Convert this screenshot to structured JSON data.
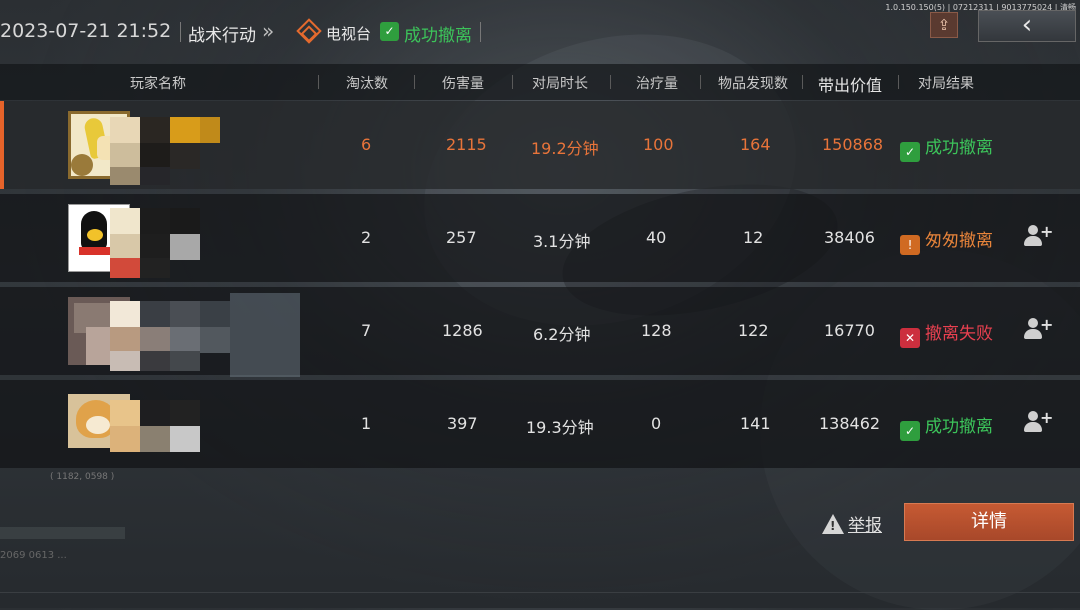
{
  "topbar": {
    "timestamp": "2023-07-21 21:52",
    "mode": "战术行动",
    "chevron": "»",
    "tv_label": "电视台",
    "status_icon": "✓",
    "status_label": "成功撤离",
    "build_info": "1.0.150.150(5) | 07212311 | 9013775024 | 清畅",
    "share_icon": "share-icon",
    "back_icon": "back-arrow-icon",
    "share_glyph": "⇪",
    "back_glyph": "‹"
  },
  "table": {
    "columns": [
      "玩家名称",
      "淘汰数",
      "伤害量",
      "对局时长",
      "治疗量",
      "物品发现数",
      "带出价值",
      "对局结果"
    ],
    "rows": [
      {
        "eliminations": "6",
        "damage": "2115",
        "duration": "19.2分钟",
        "healing": "100",
        "items": "164",
        "value": "150868",
        "result": "成功撤离",
        "result_type": "ok",
        "result_icon": "✓",
        "highlight": true
      },
      {
        "eliminations": "2",
        "damage": "257",
        "duration": "3.1分钟",
        "healing": "40",
        "items": "12",
        "value": "38406",
        "result": "匆匆撤离",
        "result_type": "hurry",
        "result_icon": "!",
        "highlight": false
      },
      {
        "eliminations": "7",
        "damage": "1286",
        "duration": "6.2分钟",
        "healing": "128",
        "items": "122",
        "value": "16770",
        "result": "撤离失败",
        "result_type": "fail",
        "result_icon": "✕",
        "highlight": false
      },
      {
        "eliminations": "1",
        "damage": "397",
        "duration": "19.3分钟",
        "healing": "0",
        "items": "141",
        "value": "138462",
        "result": "成功撤离",
        "result_type": "ok",
        "result_icon": "✓",
        "highlight": false
      }
    ]
  },
  "footer": {
    "coords": "( 1182, 0598 )",
    "report_label": "举报",
    "detail_label": "详情",
    "bottom_hint": "2069 0613 ..."
  },
  "colors": {
    "accent_orange": "#e6632a",
    "success_green": "#3cc45a",
    "hurry_orange": "#e8843a",
    "fail_red": "#e84050"
  }
}
